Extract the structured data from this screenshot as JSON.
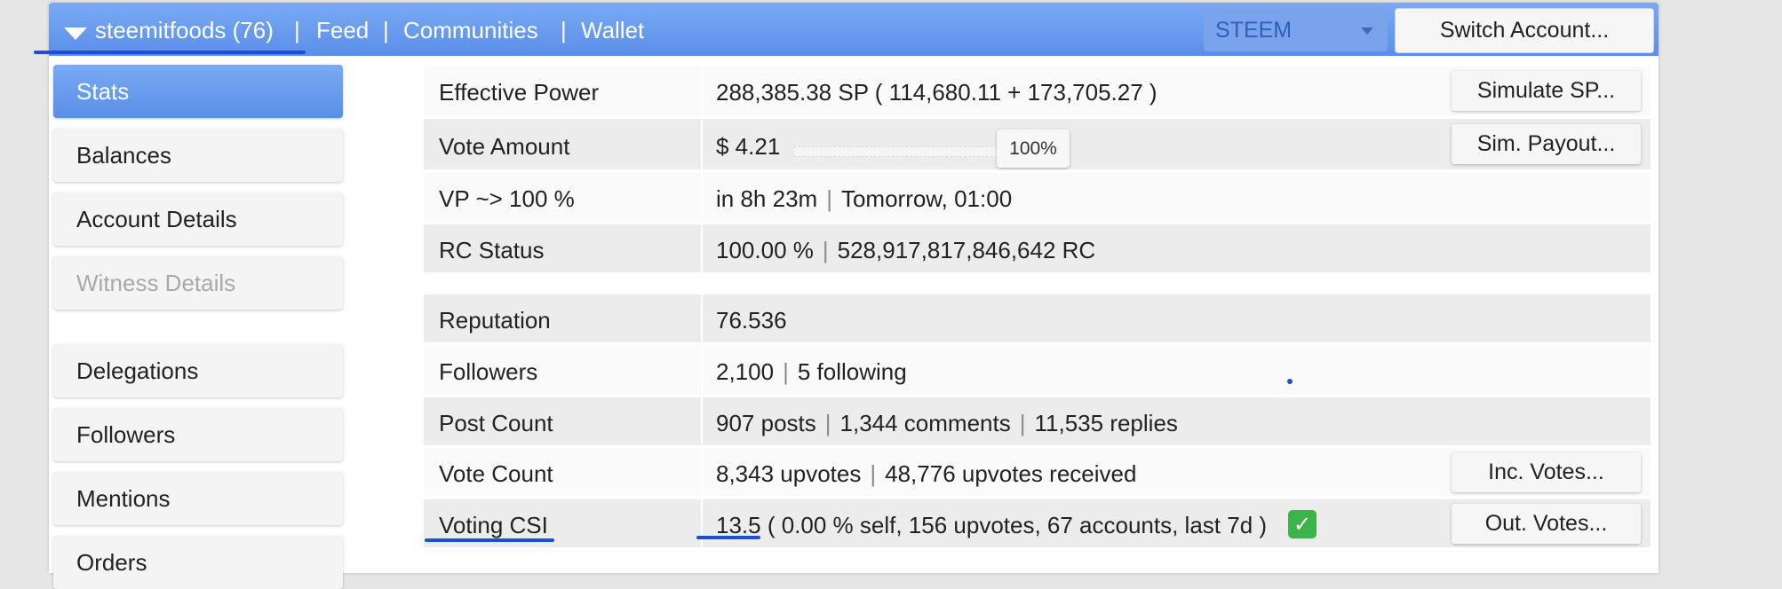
{
  "header": {
    "account": "steemitfoods (76)",
    "nav": [
      "Feed",
      "Communities",
      "Wallet"
    ],
    "separator": "|",
    "chain_select": "STEEM",
    "switch_account": "Switch Account..."
  },
  "sidebar": {
    "items": [
      {
        "label": "Stats",
        "state": "active"
      },
      {
        "label": "Balances",
        "state": "normal"
      },
      {
        "label": "Account Details",
        "state": "normal"
      },
      {
        "label": "Witness Details",
        "state": "disabled"
      },
      {
        "label": "Delegations",
        "state": "normal"
      },
      {
        "label": "Followers",
        "state": "normal"
      },
      {
        "label": "Mentions",
        "state": "normal"
      },
      {
        "label": "Orders",
        "state": "normal"
      }
    ]
  },
  "stats": {
    "effective_power": {
      "label": "Effective Power",
      "value": "288,385.38 SP ( 114,680.11 + 173,705.27 )",
      "button": "Simulate SP..."
    },
    "vote_amount": {
      "label": "Vote Amount",
      "value": "$ 4.21",
      "slider_percent": "100%",
      "slider_level": 100,
      "button": "Sim. Payout..."
    },
    "vp": {
      "label": "VP ~> 100 %",
      "time": "in 8h 23m",
      "when": "Tomorrow, 01:00"
    },
    "rc_status": {
      "label": "RC Status",
      "percent": "100.00 %",
      "amount": "528,917,817,846,642 RC"
    },
    "reputation": {
      "label": "Reputation",
      "value": "76.536"
    },
    "followers": {
      "label": "Followers",
      "count": "2,100",
      "following": "5 following"
    },
    "post_count": {
      "label": "Post Count",
      "posts": "907 posts",
      "comments": "1,344 comments",
      "replies": "11,535 replies"
    },
    "vote_count": {
      "label": "Vote Count",
      "upvotes": "8,343 upvotes",
      "received": "48,776 upvotes received",
      "button": "Inc. Votes..."
    },
    "voting_csi": {
      "label": "Voting CSI",
      "score": "13.5",
      "details": " ( 0.00 % self, 156 upvotes, 67 accounts, last 7d ) ",
      "icon": "check-mark-icon",
      "button": "Out. Votes..."
    }
  },
  "colors": {
    "accent": "#5a8ee8",
    "annotation": "#1a4fd6",
    "check": "#3bb54a"
  }
}
